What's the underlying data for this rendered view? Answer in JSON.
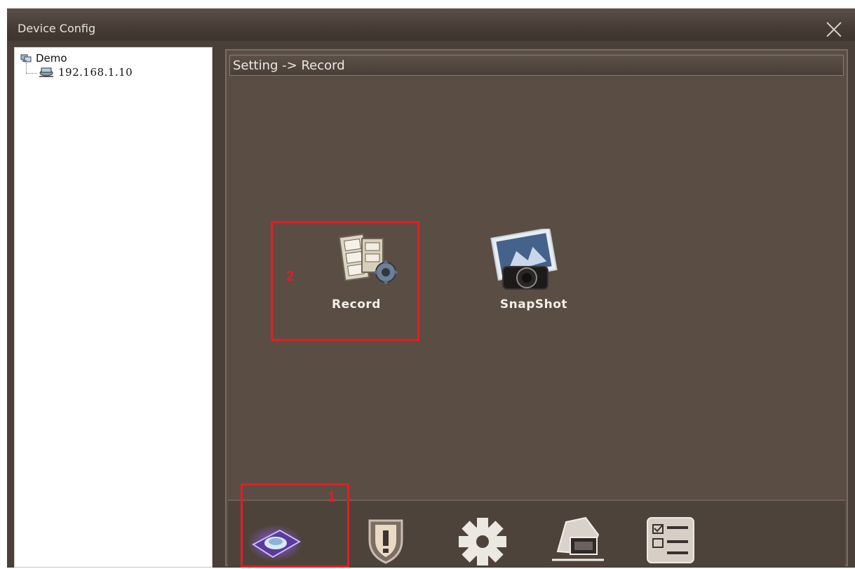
{
  "window": {
    "title": "Device Config"
  },
  "tree": {
    "root": {
      "label": "Demo"
    },
    "child": {
      "label": "192.168.1.10"
    }
  },
  "panel": {
    "breadcrumb": "Setting -> Record",
    "tiles": [
      {
        "label": "Record",
        "icon": "record-settings-icon"
      },
      {
        "label": "SnapShot",
        "icon": "snapshot-camera-icon"
      }
    ],
    "annotations": {
      "first": "1",
      "second": "2"
    },
    "dock": [
      {
        "icon": "storage-disk-icon",
        "selected": true
      },
      {
        "icon": "alarm-shield-icon"
      },
      {
        "icon": "settings-gear-icon"
      },
      {
        "icon": "network-system-icon"
      },
      {
        "icon": "checklist-info-icon"
      }
    ]
  },
  "colors": {
    "highlight": "#e31d25",
    "background": "#5a4d44"
  }
}
